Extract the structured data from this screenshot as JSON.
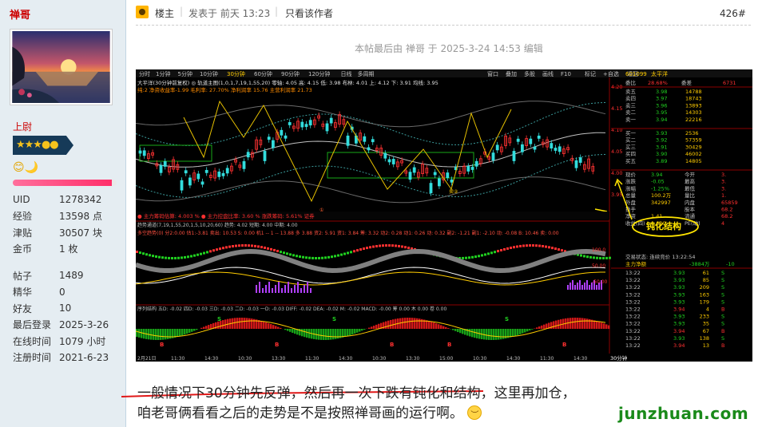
{
  "user": {
    "name": "禅哥",
    "rank": "上尉",
    "stars": "★★★●●",
    "emoticons": "😊🌙",
    "progress": 0.95,
    "stats": [
      {
        "k": "UID",
        "v": "1278342"
      },
      {
        "k": "经验",
        "v": "13598 点"
      },
      {
        "k": "津贴",
        "v": "30507 块"
      },
      {
        "k": "金币",
        "v": "1 枚"
      }
    ],
    "stats2": [
      {
        "k": "帖子",
        "v": "1489"
      },
      {
        "k": "精华",
        "v": "0"
      },
      {
        "k": "好友",
        "v": "10"
      },
      {
        "k": "最后登录",
        "v": "2025-3-26"
      },
      {
        "k": "在线时间",
        "v": "1079 小时"
      },
      {
        "k": "注册时间",
        "v": "2021-6-23"
      }
    ]
  },
  "post": {
    "louzhu": "楼主",
    "posted": "发表于 前天 13:23",
    "only_author": "只看该作者",
    "floor": "426#",
    "edit_note": "本帖最后由 禅哥 于 2025-3-24 14:53 编辑",
    "line1": "一般情况下30分钟先反弹，然后再一次下跌有钝化和结构，这里再加仓，",
    "line2": "咱老哥俩看看之后的走势是不是按照禅哥画的运行啊。"
  },
  "chart": {
    "toolbar_left": [
      "分时",
      "1分钟",
      "5分钟",
      "10分钟",
      "30分钟",
      "60分钟",
      "90分钟",
      "120分钟",
      "日线",
      "多周期"
    ],
    "toolbar_right": [
      "窗口",
      "叠加",
      "多股",
      "画线",
      "F10",
      "标记",
      "+自选",
      "返回"
    ],
    "main_title": "大平洋(30分钟前复权) ◎ 轨道主图(1,0,1,7,19,1,55,20) 零轴: 4.05 高: 4.15 低: 3.98 布林: 4.01 上: 4.12 下: 3.91 均线: 3.95",
    "sub_title": "纯:2  净资收益率-1.99 毛利率: 27.70% 净利润率 15.76 主营利润率 21.73",
    "volume_bar": "● 主力筹码估算: 4.003 % ● 主力控盘比率: 3.60 % 涨跌筹码: 5.61% 证券",
    "ind1_title": "趋势通道(7,19,1,55,20,1,5,10,20,60) 趋势: 4.02 短期: 4.00 中期: 4.00",
    "ind2_title": "多空趋势(0) 分2:0.00 估1:-3.81 卖出: 10.53 S: 0.00 机1 -- 1 -- 13.88 多 3.88 资2: 5.91 资1: 3.84 筹: 3.32 动2: 0.28 动1: 0.26 动: 0.32 副2: -1.21 副1: -2.10 动: -0.08 B: 10.46 卖: 0.00",
    "ind3_title": "序列结构 五D: -0.02 四D: -0.03 三D: -0.03 二D: -0.03 一D: -0.03 DIFF: -0.02 DEA: -0.02 M: -0.02 MACD: -0.00 筹 0.00 木 0.00 卷 0.00",
    "stock_code": "601099",
    "stock_name": "太平洋",
    "wei_bi": "委比",
    "wei_bi_val": "28.68%",
    "wei_cha": "委差",
    "wei_cha_val": "6731",
    "sells": [
      {
        "k": "卖五",
        "p": "3.98",
        "v": "14788"
      },
      {
        "k": "卖四",
        "p": "3.97",
        "v": "18743"
      },
      {
        "k": "卖三",
        "p": "3.96",
        "v": "13893"
      },
      {
        "k": "卖二",
        "p": "3.95",
        "v": "14303"
      },
      {
        "k": "卖一",
        "p": "3.94",
        "v": "22216"
      }
    ],
    "buys": [
      {
        "k": "买一",
        "p": "3.93",
        "v": "2536"
      },
      {
        "k": "买二",
        "p": "3.92",
        "v": "57359"
      },
      {
        "k": "买三",
        "p": "3.91",
        "v": "30429"
      },
      {
        "k": "买四",
        "p": "3.90",
        "v": "46002"
      },
      {
        "k": "买五",
        "p": "3.89",
        "v": "14805"
      }
    ],
    "quote": [
      {
        "k": "现价",
        "v": "3.94",
        "k2": "今开",
        "v2": "3."
      },
      {
        "k": "涨跌",
        "v": "-0.05",
        "k2": "最高",
        "v2": "3."
      },
      {
        "k": "涨幅",
        "v": "-1.25%",
        "k2": "最低",
        "v2": "3."
      },
      {
        "k": "总量",
        "v": "100.2万",
        "k2": "量比",
        "v2": "1."
      },
      {
        "k": "外盘",
        "v": "342997",
        "k2": "内盘",
        "v2": "65859"
      },
      {
        "k": "换手",
        "v": "",
        "k2": "股本",
        "v2": "68.2"
      },
      {
        "k": "净资",
        "v": "1.41",
        "k2": "流通",
        "v2": "68.2"
      },
      {
        "k": "收益(四)",
        "v": "0.020",
        "k2": "PE(动)",
        "v2": "4"
      }
    ],
    "trade_status": "交易状态: 连续竞价 13:22:54",
    "net_flow_label": "主力净额",
    "net_flow_val": "-3884万",
    "net_flow_pct": "-10",
    "ticks": [
      {
        "t": "13:22",
        "p": "3.93",
        "v": "61",
        "s": "S"
      },
      {
        "t": "13:22",
        "p": "3.93",
        "v": "85",
        "s": "S"
      },
      {
        "t": "13:22",
        "p": "3.93",
        "v": "209",
        "s": "S"
      },
      {
        "t": "13:22",
        "p": "3.93",
        "v": "163",
        "s": "S"
      },
      {
        "t": "13:22",
        "p": "3.93",
        "v": "179",
        "s": "S"
      },
      {
        "t": "13:22",
        "p": "3.94",
        "v": "4",
        "s": "B"
      },
      {
        "t": "13:22",
        "p": "3.93",
        "v": "233",
        "s": "S"
      },
      {
        "t": "13:22",
        "p": "3.93",
        "v": "35",
        "s": "S"
      },
      {
        "t": "13:22",
        "p": "3.94",
        "v": "67",
        "s": "B"
      },
      {
        "t": "13:22",
        "p": "3.93",
        "v": "138",
        "s": "S"
      },
      {
        "t": "13:22",
        "p": "3.94",
        "v": "13",
        "s": "B"
      }
    ],
    "price_axis": [
      "4.20",
      "4.15",
      "4.10",
      "4.05",
      "4.00",
      "3.95"
    ],
    "annotation": "钝化结构",
    "time_axis": [
      "2月21日",
      "11:30",
      "14:30",
      "10:30",
      "13:30",
      "11:30",
      "14:30",
      "10:30",
      "13:30",
      "15:00",
      "10:30",
      "14:30",
      "11:30",
      "14:30"
    ],
    "period_tab": "30分钟"
  },
  "watermark": "junzhuan.com"
}
